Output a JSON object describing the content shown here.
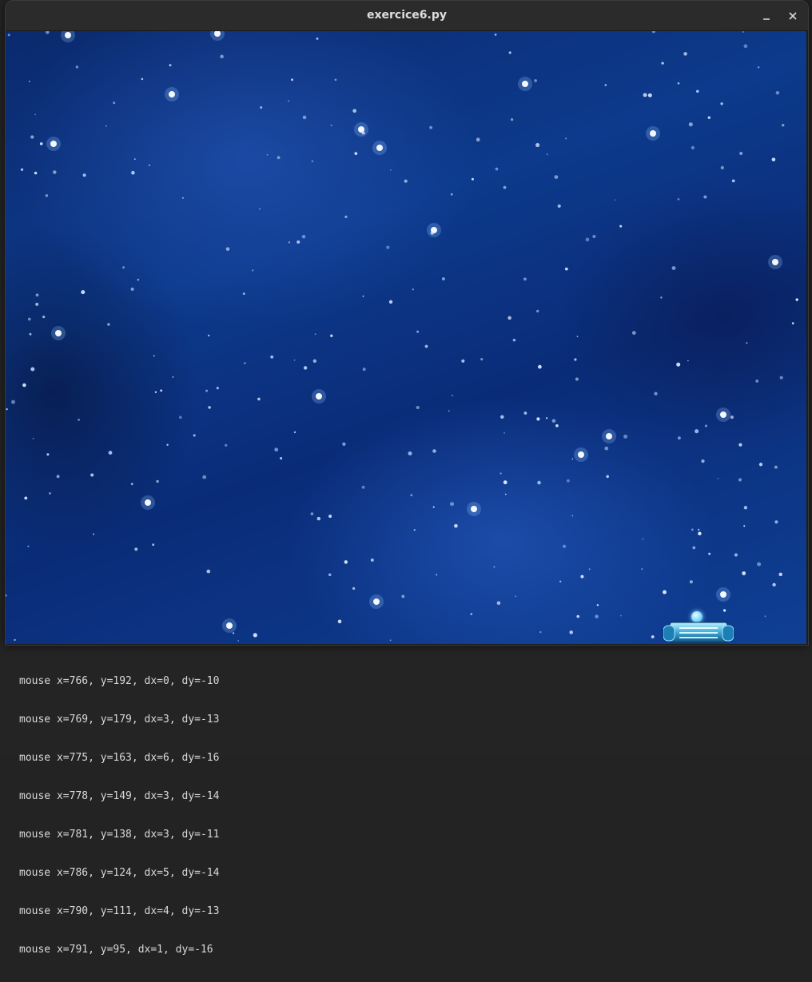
{
  "window": {
    "title": "exercice6.py",
    "minimize_icon": "minimize-icon",
    "close_icon": "close-icon"
  },
  "terminal": {
    "lines": [
      "mouse x=766, y=192, dx=0, dy=-10",
      "mouse x=769, y=179, dx=3, dy=-13",
      "mouse x=775, y=163, dx=6, dy=-16",
      "mouse x=778, y=149, dx=3, dy=-14",
      "mouse x=781, y=138, dx=3, dy=-11",
      "mouse x=786, y=124, dx=5, dy=-14",
      "mouse x=790, y=111, dx=4, dy=-13",
      "mouse x=791, y=95, dx=1, dy=-16"
    ]
  },
  "game": {
    "background": "starfield",
    "sprites": [
      "paddle",
      "ball"
    ],
    "colors": {
      "space_dark": "#0a2c78",
      "space_light": "#1f5fbf",
      "paddle": "#4fc3e8",
      "ball": "#9fe6ff"
    }
  }
}
